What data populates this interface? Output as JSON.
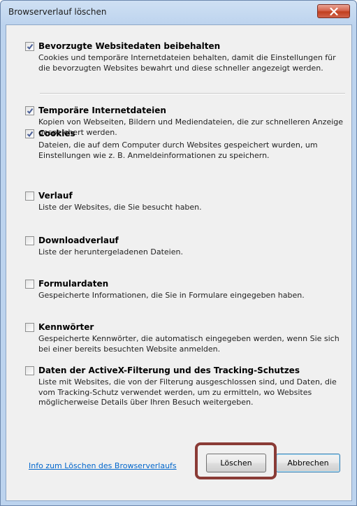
{
  "window": {
    "title": "Browserverlauf löschen"
  },
  "items": [
    {
      "title": "Bevorzugte Websitedaten beibehalten",
      "description": "Cookies und temporäre Internetdateien behalten, damit die Einstellungen für die bevorzugten Websites bewahrt und diese schneller angezeigt werden.",
      "checked": true
    },
    {
      "title": "Temporäre Internetdateien",
      "description": "Kopien von Webseiten, Bildern und Mediendateien, die zur schnelleren Anzeige gespeichert werden.",
      "checked": true
    },
    {
      "title": "Cookies",
      "description": "Dateien, die auf dem Computer durch Websites gespeichert wurden, um Einstellungen wie z. B. Anmeldeinformationen zu speichern.",
      "checked": true
    },
    {
      "title": "Verlauf",
      "description": "Liste der Websites, die Sie besucht haben.",
      "checked": false
    },
    {
      "title": "Downloadverlauf",
      "description": "Liste der heruntergeladenen Dateien.",
      "checked": false
    },
    {
      "title": "Formulardaten",
      "description": "Gespeicherte Informationen, die Sie in Formulare eingegeben haben.",
      "checked": false
    },
    {
      "title": "Kennwörter",
      "description": "Gespeicherte Kennwörter, die automatisch eingegeben werden, wenn Sie sich bei einer bereits besuchten Website anmelden.",
      "checked": false
    },
    {
      "title": "Daten der ActiveX-Filterung und des Tracking-Schutzes",
      "description": "Liste mit Websites, die von der Filterung ausgeschlossen sind, und Daten, die vom Tracking-Schutz verwendet werden, um zu ermitteln, wo Websites möglicherweise Details über Ihren Besuch weitergeben.",
      "checked": false
    }
  ],
  "footer": {
    "info_link": "Info zum Löschen des Browserverlaufs",
    "delete_label": "Löschen",
    "cancel_label": "Abbrechen"
  },
  "colors": {
    "link": "#0066cc",
    "highlight_frame": "#8a3b36",
    "close_button": "#c1401f"
  }
}
